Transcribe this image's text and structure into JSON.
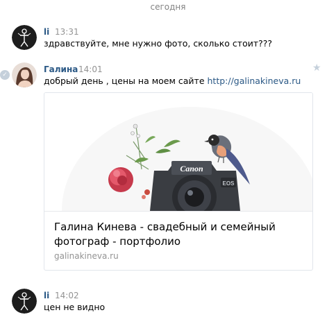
{
  "date_separator": "сегодня",
  "messages": [
    {
      "sender": "li",
      "time": "13:31",
      "text": "здравствуйте, мне нужно фото, сколько стоит???"
    },
    {
      "sender": "Галина",
      "time": "14:01",
      "text": "добрый день , цены на моем сайте ",
      "link": "http://galinakineva.ru"
    },
    {
      "sender": "li",
      "time": "14:02",
      "text": "цен не видно"
    }
  ],
  "link_card": {
    "title": "Галина Кинева - свадебный и семейный фотограф - портфолио",
    "domain": "galinakineva.ru",
    "camera_brand": "Canon",
    "camera_model": "EOS"
  },
  "icons": {
    "read_check": "check-icon",
    "favorite": "star-icon"
  },
  "colors": {
    "link": "#2a5885",
    "meta": "#939393",
    "separator": "#828282"
  }
}
